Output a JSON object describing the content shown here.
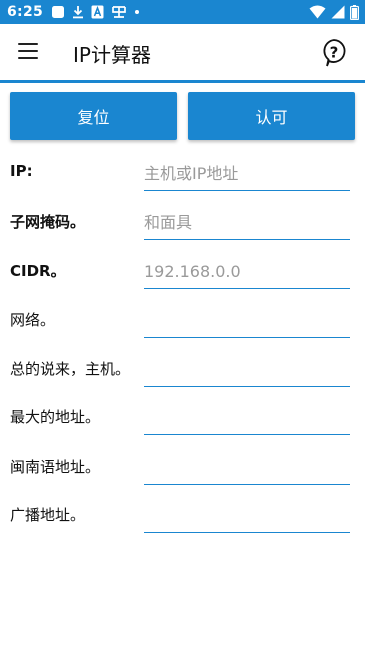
{
  "status_bar": {
    "time": "6:25",
    "icons_left": [
      "square-icon",
      "download-icon",
      "font-icon",
      "bug-icon",
      "dot-icon"
    ],
    "icons_right": [
      "wifi-icon",
      "signal-icon",
      "battery-icon"
    ]
  },
  "app_bar": {
    "title": "IP计算器",
    "menu_icon": "menu-icon",
    "help_icon": "help-icon"
  },
  "buttons": {
    "reset": "复位",
    "ok": "认可"
  },
  "form": {
    "ip": {
      "label": "IP:",
      "value": "",
      "placeholder": "主机或IP地址"
    },
    "subnet_mask": {
      "label": "子网掩码。",
      "value": "",
      "placeholder": "和面具"
    },
    "cidr": {
      "label": "CIDR。",
      "value": "",
      "placeholder": "192.168.0.0"
    },
    "network": {
      "label": "网络。",
      "value": "",
      "placeholder": ""
    },
    "total_hosts": {
      "label": "总的说来，主机。",
      "value": "",
      "placeholder": ""
    },
    "max_address": {
      "label": "最大的地址。",
      "value": "",
      "placeholder": ""
    },
    "min_address": {
      "label": "闽南语地址。",
      "value": "",
      "placeholder": ""
    },
    "broadcast": {
      "label": "广播地址。",
      "value": "",
      "placeholder": ""
    }
  },
  "colors": {
    "accent": "#1a86d0",
    "text": "#111111",
    "placeholder": "#9a9a9a",
    "background": "#ffffff"
  }
}
